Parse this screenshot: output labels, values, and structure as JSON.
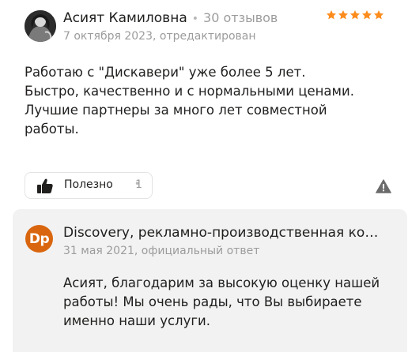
{
  "review": {
    "author_name": "Асият Камиловна",
    "reviews_count": "30 отзывов",
    "rating": 5,
    "date": "7 октября 2023, отредактирован",
    "text_lines": [
      "Работаю с \"Дискавери\" уже более 5 лет.",
      "Быстро, качественно и с нормальными ценами.",
      "Лучшие партнеры за много лет совместной работы."
    ],
    "useful_label": "Полезно",
    "useful_count": "1",
    "icons": {
      "avatar": "user-photo",
      "star": "star-icon",
      "useful": "thumb-up-icon",
      "report": "warning-icon"
    },
    "colors": {
      "star": "#fc8c1c",
      "text": "#21201f",
      "muted": "#9c9c9c"
    }
  },
  "reply": {
    "avatar_initials": "Dp",
    "org_name": "Discovery, рекламно-производственная компания",
    "date": "31 мая 2021, официальный ответ",
    "text": "Асият, благодарим за высокую оценку нашей работы! Мы очень рады, что Вы выбираете именно наши услуги.",
    "colors": {
      "background": "#f2f2f2",
      "avatar": "#d9660e"
    }
  }
}
